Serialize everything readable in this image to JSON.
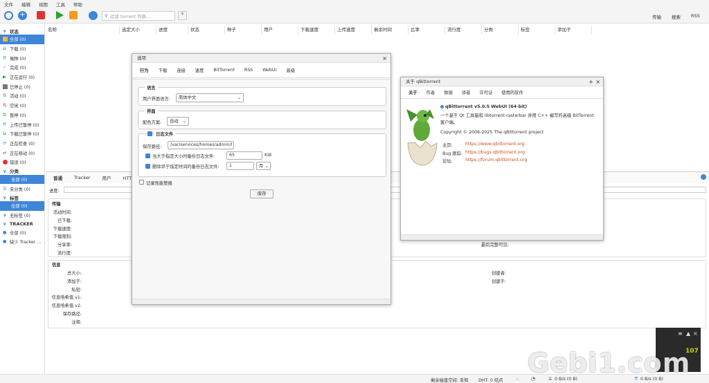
{
  "menu": [
    "文件",
    "编辑",
    "视图",
    "工具",
    "帮助"
  ],
  "toolbar": {
    "filter_placeholder": "过滤 torrent 列表...",
    "right_tabs": [
      "传输",
      "搜索",
      "RSS"
    ]
  },
  "sidebar": {
    "status_header": "状态",
    "status": [
      "全部 (0)",
      "下载 (0)",
      "做种 (0)",
      "完成 (0)",
      "正在运行 (0)",
      "已停止 (0)",
      "活动 (0)",
      "空闲 (0)",
      "暂停 (0)",
      "上传已暂停 (0)",
      "下载已暂停 (0)",
      "正在检查 (0)",
      "正在移动 (0)",
      "错误 (0)"
    ],
    "category_header": "分类",
    "categories": [
      "全部 (0)",
      "未分类 (0)"
    ],
    "tag_header": "标签",
    "tags": [
      "全部 (0)",
      "无标签 (0)"
    ],
    "tracker_header": "TRACKER",
    "trackers": [
      "全部 (0)",
      "缺少 Tracker ..."
    ]
  },
  "table": {
    "columns": [
      "名称",
      "选定大小",
      "进度",
      "状态",
      "种子",
      "用户",
      "下载速度",
      "上传速度",
      "剩余时间",
      "比率",
      "流行度",
      "分类",
      "标签",
      "添加于"
    ]
  },
  "props": {
    "tabs": [
      "普通",
      "Tracker",
      "用户",
      "HTTP 源"
    ],
    "progress_label": "进度:",
    "transfer_header": "传输",
    "transfer_fields": [
      "活动时间:",
      "已下载:",
      "下载速度:",
      "下载限制:",
      "分享率:",
      "流行度:"
    ],
    "last_seen": "最后完整可见:",
    "info_header": "信息",
    "info_fields": [
      "总大小:",
      "添加于:",
      "私密:",
      "信息哈希值 v1:",
      "信息哈希值 v2:",
      "保存路径:",
      "注释:"
    ],
    "created_by": "创建者:",
    "created_on": "创建于:"
  },
  "options": {
    "title": "选项",
    "tabs": [
      "行为",
      "下载",
      "连接",
      "速度",
      "BitTorrent",
      "RSS",
      "WebUI",
      "高级"
    ],
    "language_group": "语言",
    "ui_language_label": "用户界面语言:",
    "ui_language_value": "简体中文",
    "interface_group": "界面",
    "theme_label": "配色方案:",
    "theme_value": "自动",
    "logfile_group": "日志文件",
    "save_path_label": "保存路径:",
    "save_path_value": "/var/services/homes/admin/l",
    "backup_label": "当大于指定大小时备份日志文件:",
    "backup_value": "65",
    "backup_unit": "KiB",
    "delete_label": "删除早于指定时间的备份日志文件:",
    "delete_value": "1",
    "delete_unit": "月",
    "perf_label": "记录性能警报",
    "save_button": "保存"
  },
  "about": {
    "title": "关于 qBittorrent",
    "tabs": [
      "关于",
      "作者",
      "致谢",
      "译者",
      "许可证",
      "使用的软件"
    ],
    "version": "qBittorrent v5.0.5 WebUI (64-bit)",
    "description": "一个基于 Qt 工具箱和 libtorrent-rasterbar 并用 C++ 编写的高级 BitTorrent 客户端。",
    "copyright": "Copyright © 2006-2025 The qBittorrent project",
    "home_label": "主页:",
    "home_url": "https://www.qbittorrent.org",
    "bug_label": "Bug 跟踪:",
    "bug_url": "https://bugs.qbittorrent.org",
    "forum_label": "论坛:",
    "forum_url": "https://forum.qbittorrent.org"
  },
  "statusbar": {
    "free_space": "剩余磁盘空间: 未知",
    "dht": "DHT: 0 结点",
    "dl": "0 B/s (0 B)",
    "ul": "0 B/s (0 B)"
  },
  "speed_widget": {
    "value": "107"
  },
  "watermark": "Gebi1.com"
}
